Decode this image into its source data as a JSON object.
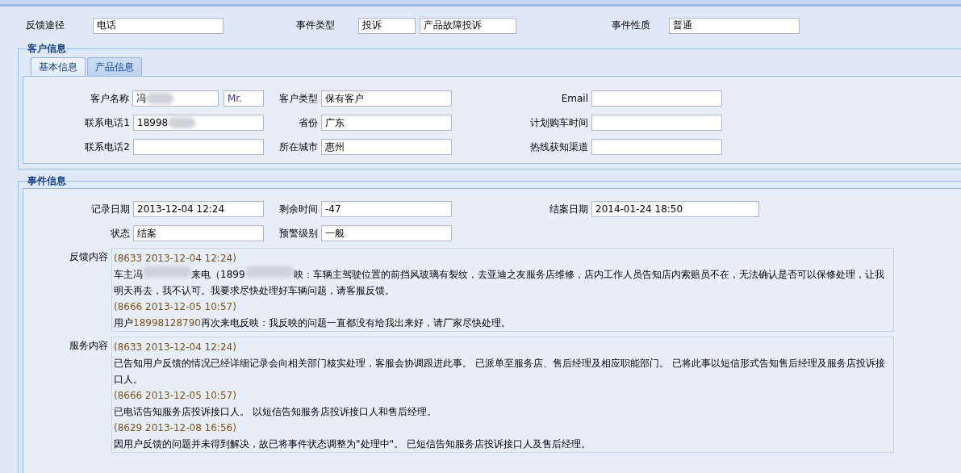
{
  "top_fields": [
    {
      "label": "反馈途径",
      "values": [
        "电话"
      ]
    },
    {
      "label": "事件类型",
      "values": [
        "投诉",
        "产品故障投诉"
      ]
    },
    {
      "label": "事件性质",
      "values": [
        "普通"
      ]
    }
  ],
  "customer_info": {
    "title": "客户信息",
    "tabs": [
      {
        "label": "基本信息",
        "selected": true
      },
      {
        "label": "产品信息",
        "selected": false
      }
    ],
    "rows": [
      [
        {
          "label": "客户名称",
          "value": "冯",
          "redacted": true,
          "suffix": "Mr."
        },
        {
          "label": "客户类型",
          "value": "保有客户"
        },
        {
          "label": "Email"
        }
      ],
      [
        {
          "label": "联系电话1",
          "value": "18998",
          "redacted": true
        },
        {
          "label": "省份",
          "value": "广东"
        },
        {
          "label": "计划购车时间"
        }
      ],
      [
        {
          "label": "联系电话2"
        },
        {
          "label": "所在城市",
          "value": "惠州"
        },
        {
          "label": "热线获知渠道"
        }
      ]
    ]
  },
  "event_info": {
    "title": "事件信息",
    "rows": [
      [
        {
          "label": "记录日期",
          "value": "2013-12-04 12:24"
        },
        {
          "label": "剩余时间",
          "value": "-47"
        },
        {
          "label": "结案日期",
          "value": "2014-01-24 18:50"
        }
      ],
      [
        {
          "label": "状态",
          "value": "结案"
        },
        {
          "label": "预警级别",
          "value": "一般"
        }
      ]
    ],
    "logs": [
      {
        "label": "反馈内容",
        "entries": [
          {
            "stamp": "(8633 2013-12-04 12:24)",
            "parts": [
              {
                "kind": "text",
                "text": "车主冯"
              },
              {
                "kind": "redacted"
              },
              {
                "kind": "text",
                "text": "来电（1899"
              },
              {
                "kind": "redacted"
              },
              {
                "kind": "text",
                "text": "映：车辆主驾驶位置的前挡风玻璃有裂纹，去亚迪之友服务店维修，店内工作人员告知店内索赔员不在，无法确认是否可以保修处理，让我明天再去，我不认可。我要求尽快处理好车辆问题，请客服反馈。"
              }
            ]
          },
          {
            "stamp": "(8666 2013-12-05 10:57)",
            "parts": [
              {
                "kind": "text",
                "text": "用户"
              },
              {
                "kind": "number",
                "text": "18998128790"
              },
              {
                "kind": "text",
                "text": "再次来电反映：我反映的问题一直都没有给我出来好，请厂家尽快处理。"
              }
            ]
          }
        ]
      },
      {
        "label": "服务内容",
        "entries": [
          {
            "stamp": "(8633 2013-12-04 12:24)",
            "parts": [
              {
                "kind": "text",
                "text": "已告知用户反馈的情况已经详细记录会向相关部门核实处理，客服会协调跟进此事。 已派单至服务店、售后经理及相应职能部门。 已将此事以短信形式告知售后经理及服务店投诉接口人。"
              }
            ]
          },
          {
            "stamp": "(8666 2013-12-05 10:57)",
            "parts": [
              {
                "kind": "text",
                "text": "已电话告知服务店投诉接口人。 以短信告知服务店投诉接口人和售后经理。"
              }
            ]
          },
          {
            "stamp": "(8629 2013-12-08 16:56)",
            "parts": [
              {
                "kind": "text",
                "text": "因用户反馈的问题并未得到解决，故已将事件状态调整为\"处理中\"。 已短信告知服务店投诉接口人及售后经理。"
              }
            ]
          }
        ]
      }
    ]
  }
}
